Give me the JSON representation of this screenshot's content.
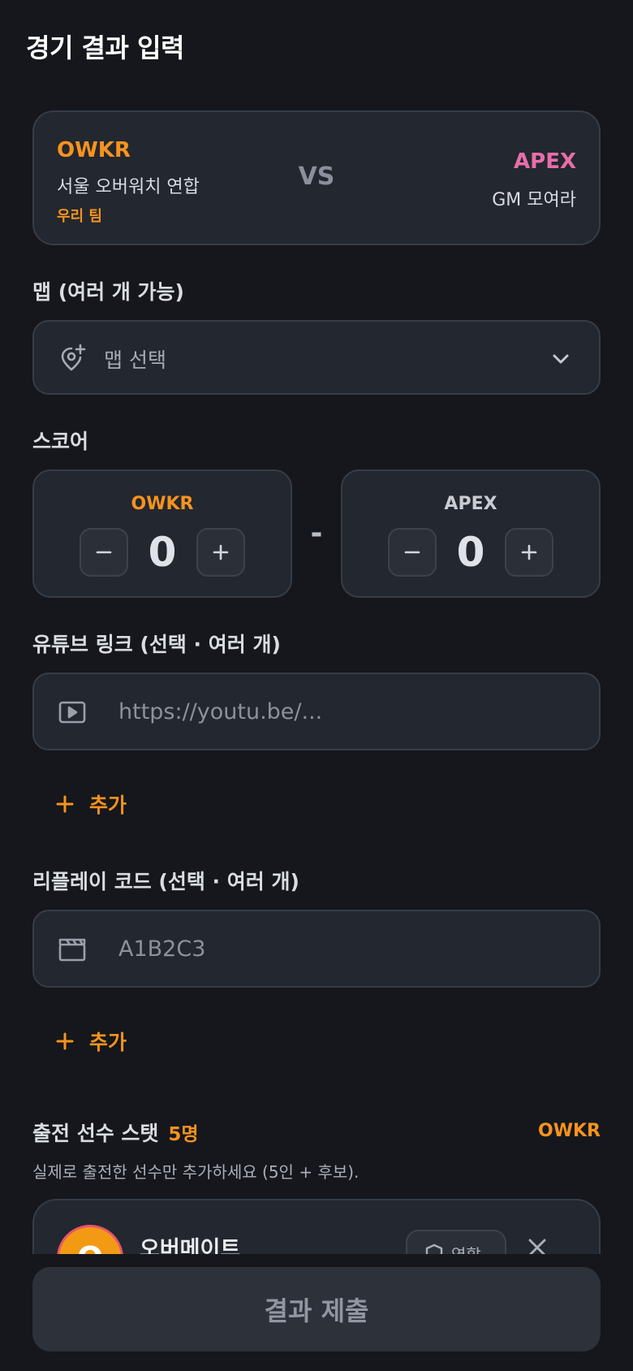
{
  "page": {
    "title": "경기 결과 입력"
  },
  "match": {
    "home": {
      "abbr": "OWKR",
      "name": "서울 오버워치 연합",
      "tag": "우리 팀"
    },
    "vs": "VS",
    "away": {
      "abbr": "APEX",
      "name": "GM 모여라"
    }
  },
  "map": {
    "label": "맵 (여러 개 가능)",
    "placeholder": "맵 선택"
  },
  "score": {
    "label": "스코어",
    "home": {
      "team": "OWKR",
      "value": "0"
    },
    "away": {
      "team": "APEX",
      "value": "0"
    },
    "separator": "-"
  },
  "youtube": {
    "label": "유튜브 링크 (선택 · 여러 개)",
    "placeholder": "https://youtu.be/...",
    "add_label": "추가"
  },
  "replay": {
    "label": "리플레이 코드 (선택 · 여러 개)",
    "placeholder": "A1B2C3",
    "add_label": "추가"
  },
  "stats": {
    "title": "출전 선수 스탯",
    "count": "5명",
    "team": "OWKR",
    "help": "실제로 출전한 선수만 추가하세요 (5인 + 후보).",
    "players": [
      {
        "initial": "O",
        "name": "오버메이트",
        "role": "역할"
      }
    ]
  },
  "submit": {
    "label": "결과 제출"
  },
  "colors": {
    "accent": "#f7931e",
    "away": "#e86ea9",
    "background": "#15171c",
    "card": "#23272f"
  },
  "icons": {
    "map": "map-pin-plus-icon",
    "dropdown": "chevron-down-icon",
    "youtube": "video-play-icon",
    "replay": "clapperboard-icon",
    "add": "plus-icon",
    "role": "shield-icon",
    "remove": "close-icon"
  }
}
